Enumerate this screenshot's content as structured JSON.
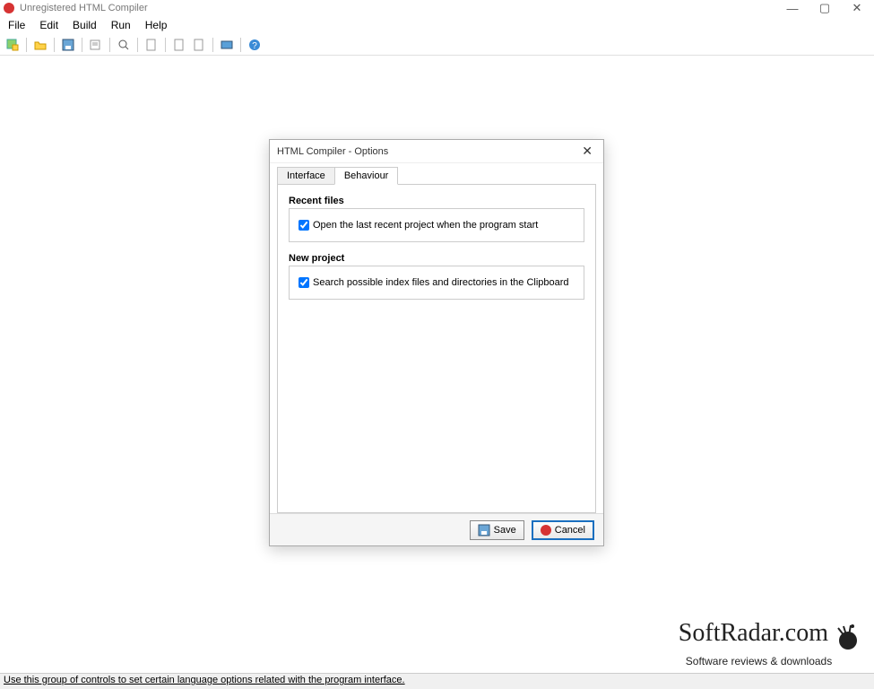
{
  "window": {
    "title": "Unregistered HTML Compiler"
  },
  "menu": {
    "file": "File",
    "edit": "Edit",
    "build": "Build",
    "run": "Run",
    "help": "Help"
  },
  "statusbar": {
    "text": "Use this group of controls to set certain language options related with the program interface."
  },
  "watermark": {
    "main": "SoftRadar.com",
    "sub": "Software reviews & downloads"
  },
  "dialog": {
    "title": "HTML Compiler - Options",
    "tabs": {
      "interface": "Interface",
      "behaviour": "Behaviour"
    },
    "group1": {
      "legend": "Recent files",
      "check1_label": "Open the last recent project when the program start",
      "check1_checked": true
    },
    "group2": {
      "legend": "New project",
      "check1_label": "Search possible index files and directories in the Clipboard",
      "check1_checked": true
    },
    "buttons": {
      "save": "Save",
      "cancel": "Cancel"
    }
  }
}
